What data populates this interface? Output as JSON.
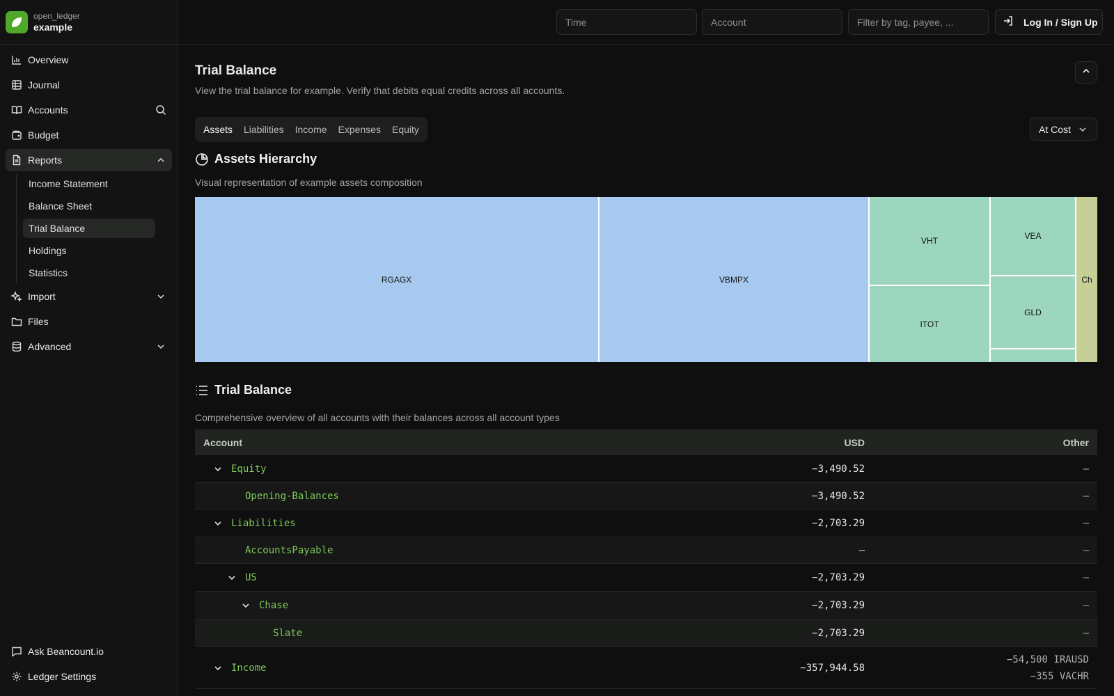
{
  "brand": {
    "sub": "open_ledger",
    "name": "example"
  },
  "sidebar": {
    "items": [
      {
        "label": "Overview"
      },
      {
        "label": "Journal"
      },
      {
        "label": "Accounts"
      },
      {
        "label": "Budget"
      },
      {
        "label": "Reports"
      },
      {
        "label": "Import"
      },
      {
        "label": "Files"
      },
      {
        "label": "Advanced"
      }
    ],
    "reports_sub": [
      {
        "label": "Income Statement"
      },
      {
        "label": "Balance Sheet"
      },
      {
        "label": "Trial Balance"
      },
      {
        "label": "Holdings"
      },
      {
        "label": "Statistics"
      }
    ],
    "bottom": [
      {
        "label": "Ask Beancount.io"
      },
      {
        "label": "Ledger Settings"
      }
    ]
  },
  "topbar": {
    "time_placeholder": "Time",
    "account_placeholder": "Account",
    "filter_placeholder": "Filter by tag, payee, ...",
    "login_label": "Log In / Sign Up"
  },
  "page": {
    "title": "Trial Balance",
    "subtitle": "View the trial balance for example. Verify that debits equal credits across all accounts."
  },
  "tabs": [
    "Assets",
    "Liabilities",
    "Income",
    "Expenses",
    "Equity"
  ],
  "valuation": "At Cost",
  "hierarchy": {
    "title": "Assets Hierarchy",
    "subtitle": "Visual representation of example assets composition"
  },
  "chart_data": {
    "type": "treemap",
    "colors": {
      "blue": "#a7c9ef",
      "green": "#9dd6bf",
      "olive": "#c6cf96"
    },
    "labels": [
      "RGAGX",
      "VBMPX",
      "VHT",
      "ITOT",
      "VEA",
      "GLD",
      "Ch"
    ]
  },
  "trial": {
    "title": "Trial Balance",
    "subtitle": "Comprehensive overview of all accounts with their balances across all account types",
    "columns": {
      "account": "Account",
      "usd": "USD",
      "other": "Other"
    },
    "rows": [
      {
        "name": "Equity",
        "usd": "−3,490.52",
        "other": "–"
      },
      {
        "name": "Opening-Balances",
        "usd": "−3,490.52",
        "other": "–"
      },
      {
        "name": "Liabilities",
        "usd": "−2,703.29",
        "other": "–"
      },
      {
        "name": "AccountsPayable",
        "usd": "–",
        "other": "–"
      },
      {
        "name": "US",
        "usd": "−2,703.29",
        "other": "–"
      },
      {
        "name": "Chase",
        "usd": "−2,703.29",
        "other": "–"
      },
      {
        "name": "Slate",
        "usd": "−2,703.29",
        "other": "–"
      },
      {
        "name": "Income",
        "usd": "−357,944.58",
        "other": "−54,500 IRAUSD",
        "other2": "−355 VACHR"
      }
    ]
  }
}
